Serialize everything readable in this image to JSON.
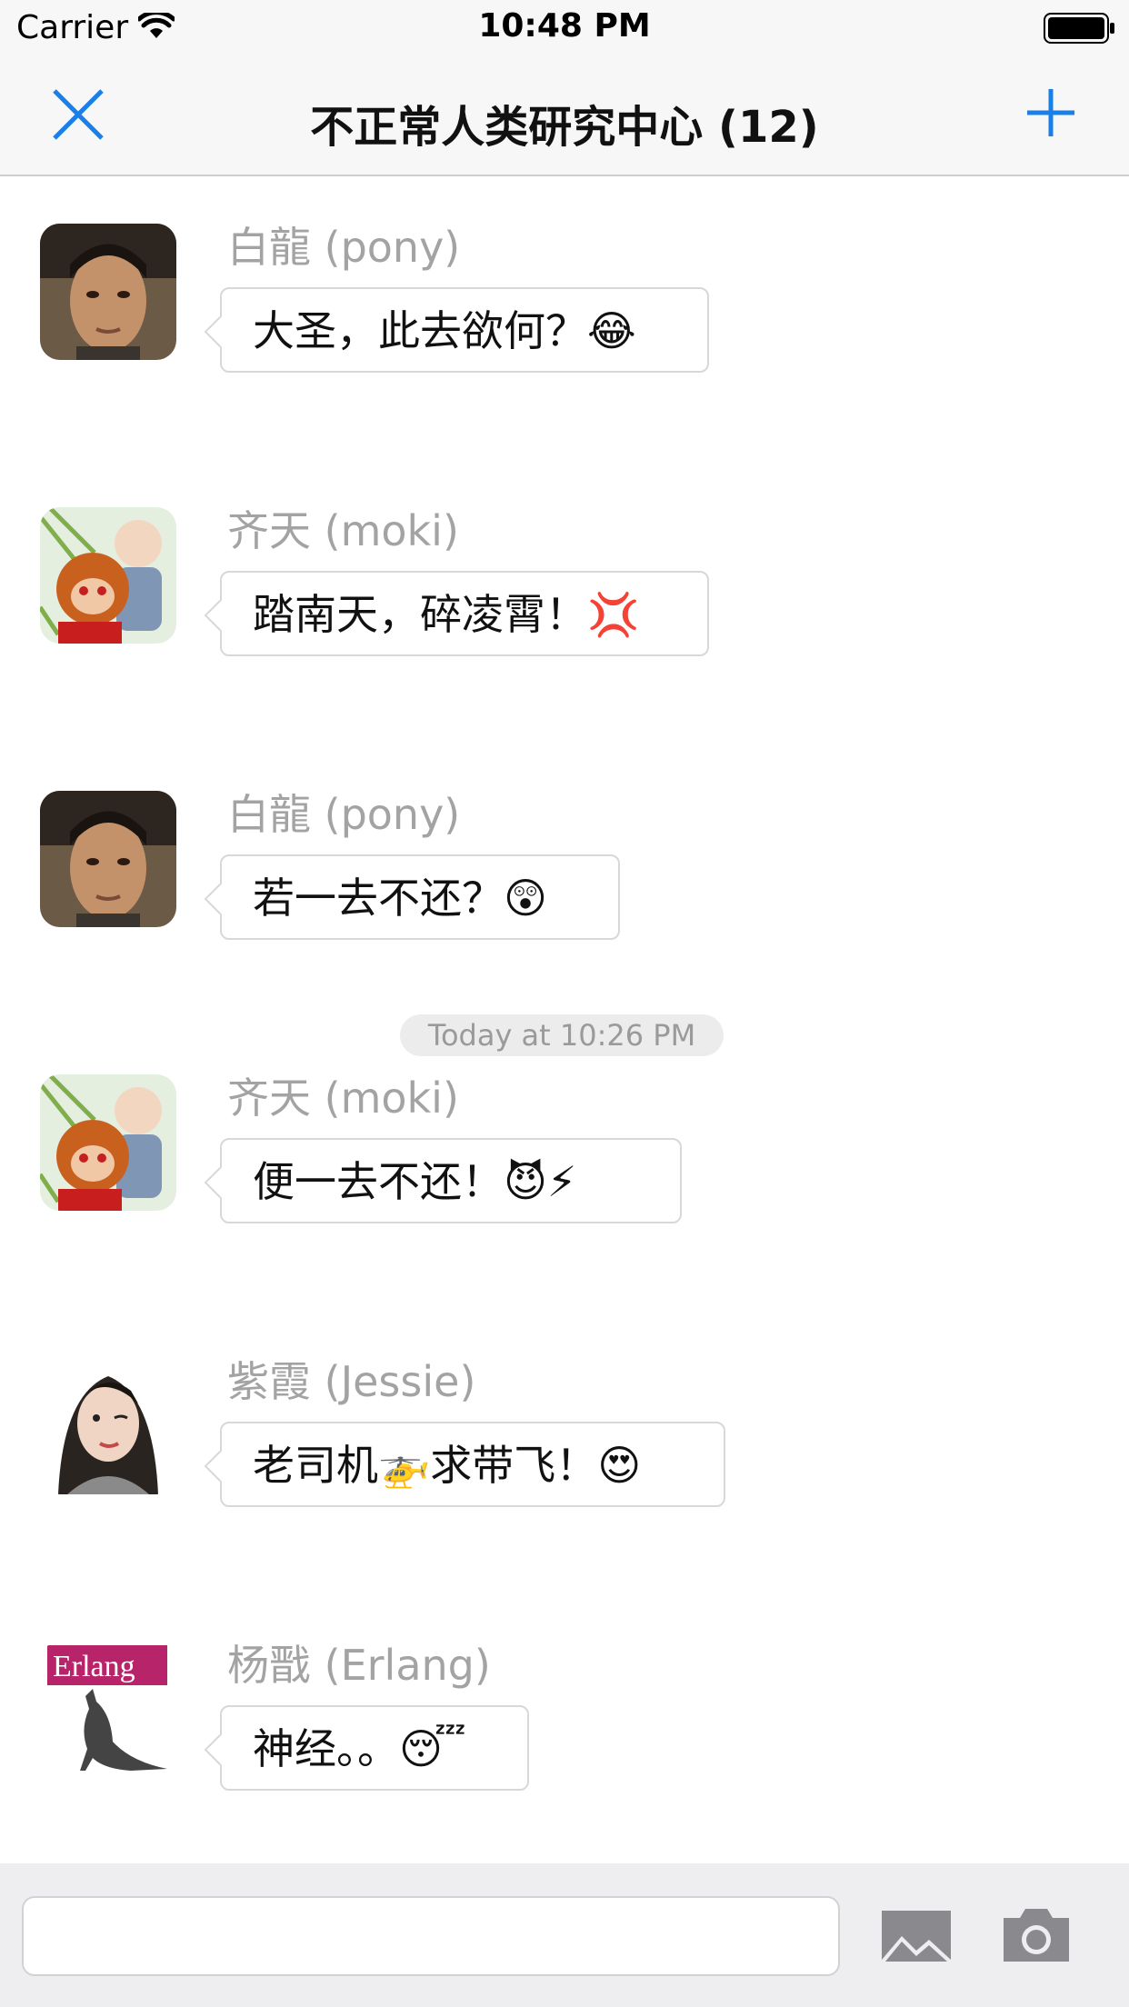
{
  "status_bar": {
    "carrier": "Carrier",
    "time": "10:48 PM"
  },
  "nav": {
    "title": "不正常人类研究中心 (12)",
    "close_icon": "close-icon",
    "add_icon": "plus-icon"
  },
  "colors": {
    "accent": "#1a7fe6",
    "sender": "#a3a3a3",
    "bubble_border": "#d8d8d8"
  },
  "messages": [
    {
      "sender": "白龍 (pony)",
      "text": "大圣，此去欲何？😂",
      "avatar": "pony-avatar"
    },
    {
      "sender": "齐天 (moki)",
      "text": "踏南天，碎凌霄！💢",
      "avatar": "moki-avatar"
    },
    {
      "sender": "白龍 (pony)",
      "text": "若一去不还？😲",
      "avatar": "pony-avatar"
    },
    {
      "sender": "齐天 (moki)",
      "text": "便一去不还！😈⚡",
      "avatar": "moki-avatar"
    },
    {
      "sender": "紫霞 (Jessie)",
      "text": "老司机🚁求带飞！😍",
      "avatar": "jessie-avatar"
    },
    {
      "sender": "杨戬 (Erlang)",
      "text": "神经。。😴",
      "avatar": "erlang-avatar"
    }
  ],
  "timestamp": "Today at 10:26 PM",
  "erlang_logo_text": "Erlang",
  "input": {
    "value": "",
    "placeholder": ""
  },
  "buttons": {
    "photo_icon": "photo-icon",
    "camera_icon": "camera-icon"
  }
}
